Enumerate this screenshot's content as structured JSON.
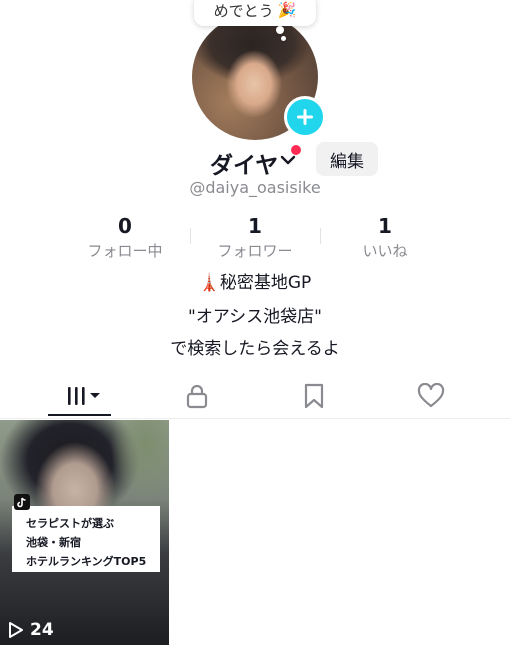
{
  "bubble": {
    "text": "めでとう",
    "emoji": "🎉"
  },
  "profile": {
    "name": "ダイヤ",
    "handle": "@daiya_oasisike",
    "edit_label": "編集"
  },
  "stats": [
    {
      "value": "0",
      "label": "フォロー中"
    },
    {
      "value": "1",
      "label": "フォロワー"
    },
    {
      "value": "1",
      "label": "いいね"
    }
  ],
  "bio": {
    "line1_emoji": "🗼",
    "line1_text": "秘密基地GP",
    "line2": "\"オアシス池袋店\"",
    "line3": "で検索したら会えるよ"
  },
  "tabs": [
    {
      "name": "videos",
      "icon": "grid-icon"
    },
    {
      "name": "private",
      "icon": "lock-icon"
    },
    {
      "name": "favorites",
      "icon": "bookmark-icon"
    },
    {
      "name": "liked",
      "icon": "heart-icon"
    }
  ],
  "video": {
    "caption_lines": [
      "セラピストが選ぶ",
      "池袋・新宿",
      "ホテルランキングTOP5"
    ],
    "play_count": "24"
  },
  "colors": {
    "accent_cyan": "#20d5ec",
    "notification_red": "#fe2c55",
    "muted_text": "#8a8b91"
  }
}
